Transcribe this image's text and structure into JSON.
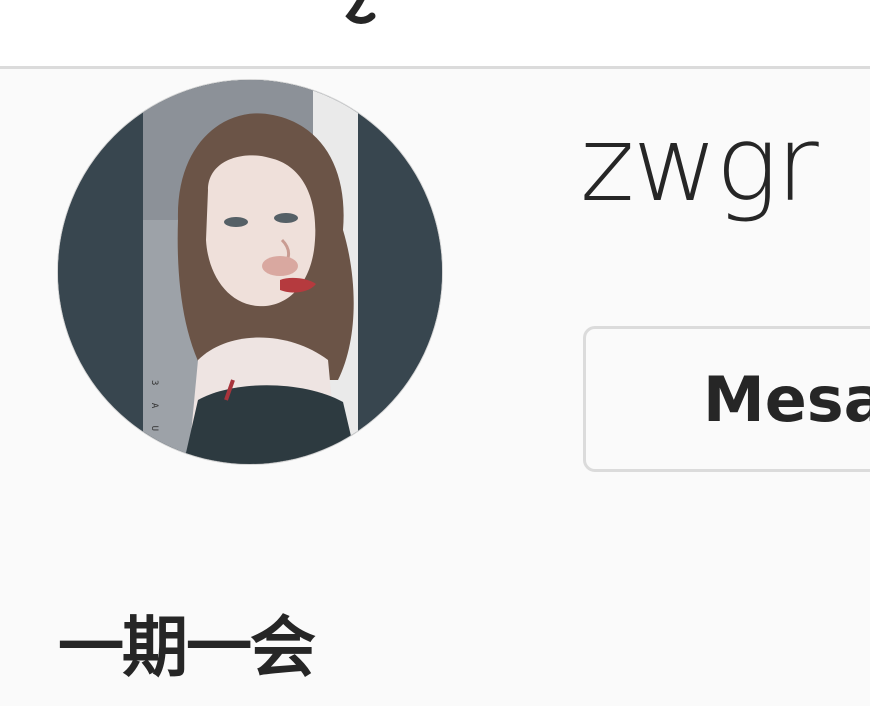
{
  "profile": {
    "username": "zwgr",
    "message_button_label": "Mesaj",
    "full_name": "一期一会",
    "avatar_caption": "3 A U 2"
  }
}
